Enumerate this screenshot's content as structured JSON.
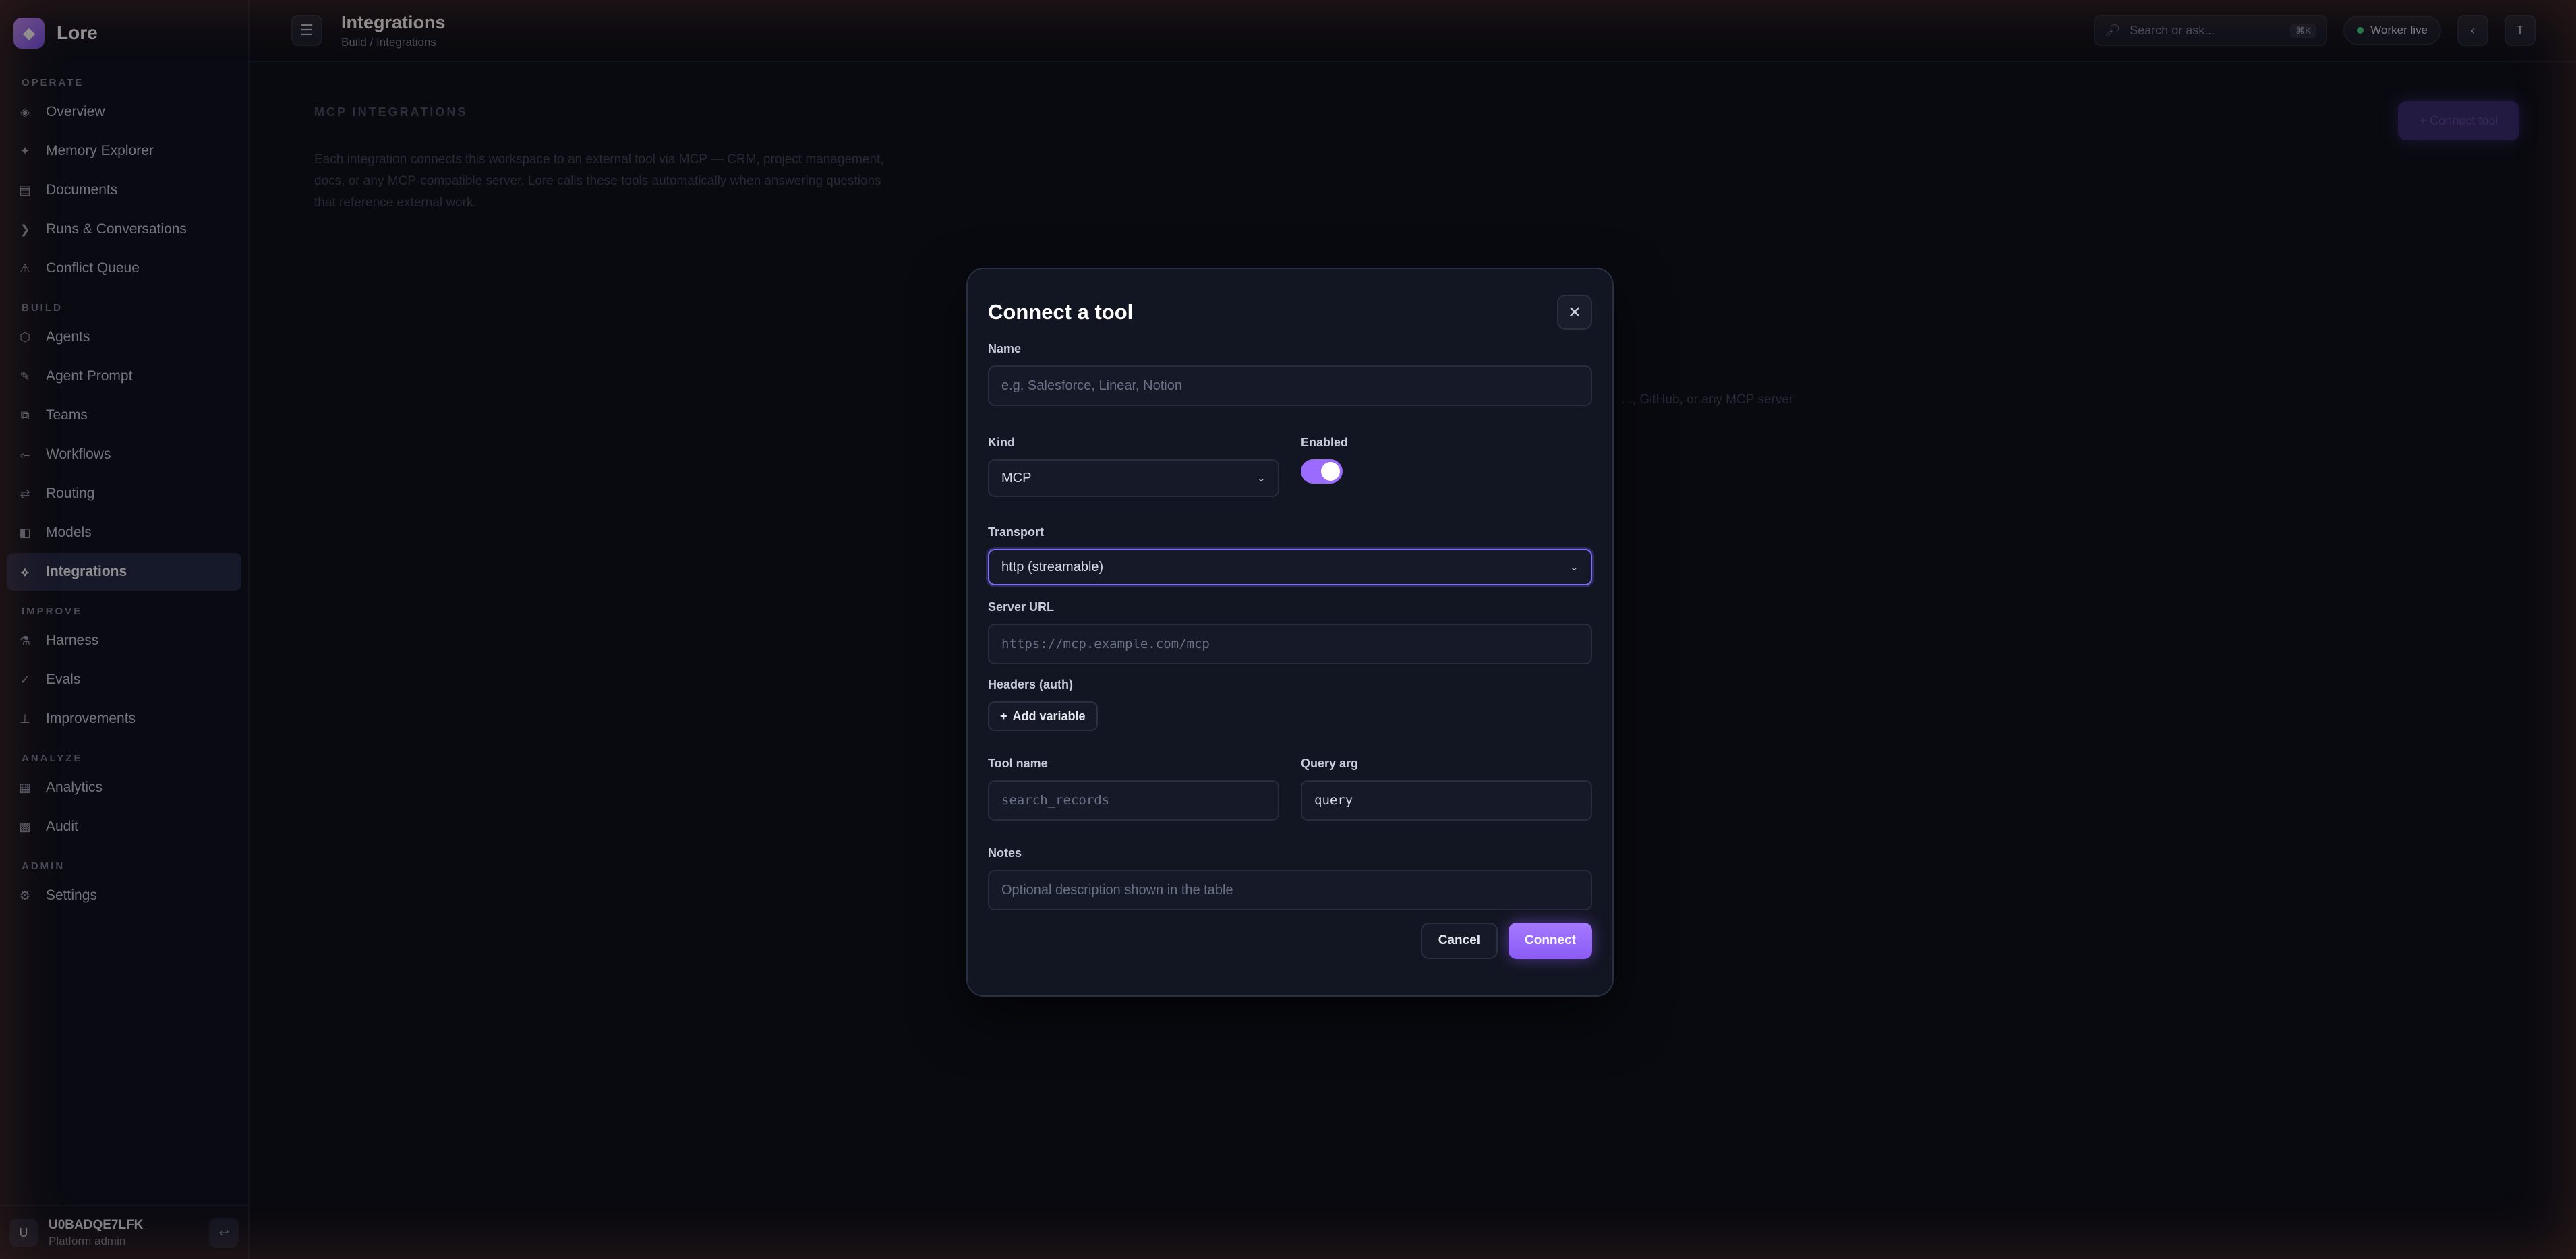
{
  "brand": {
    "name": "Lore"
  },
  "sidebar": {
    "sections": {
      "operate": "OPERATE",
      "build": "BUILD",
      "improve": "IMPROVE",
      "analyze": "ANALYZE",
      "admin": "ADMIN"
    },
    "items": {
      "overview": "Overview",
      "memory_explorer": "Memory Explorer",
      "documents": "Documents",
      "runs": "Runs & Conversations",
      "conflict_queue": "Conflict Queue",
      "agents": "Agents",
      "agent_prompt": "Agent Prompt",
      "teams": "Teams",
      "workflows": "Workflows",
      "routing": "Routing",
      "models": "Models",
      "integrations": "Integrations",
      "harness": "Harness",
      "evals": "Evals",
      "improvements": "Improvements",
      "analytics": "Analytics",
      "audit": "Audit",
      "settings": "Settings"
    },
    "user": {
      "avatar": "U",
      "name": "U0BADQE7LFK",
      "role": "Platform admin"
    }
  },
  "header": {
    "title": "Integrations",
    "breadcrumb": "Build / Integrations",
    "search_placeholder": "Search or ask...",
    "search_shortcut": "⌘K",
    "status": "Worker live",
    "avatar": "T"
  },
  "page": {
    "section_title": "MCP INTEGRATIONS",
    "description": "Each integration connects this workspace to an external tool via MCP — CRM, project management, docs, or any MCP-compatible server. Lore calls these tools automatically when answering questions that reference external work.",
    "connect_button": "+ Connect tool",
    "behind_text": "..., GitHub, or any MCP server"
  },
  "modal": {
    "title": "Connect a tool",
    "name_label": "Name",
    "name_placeholder": "e.g. Salesforce, Linear, Notion",
    "kind_label": "Kind",
    "kind_value": "MCP",
    "enabled_label": "Enabled",
    "enabled": true,
    "transport_label": "Transport",
    "transport_value": "http (streamable)",
    "server_url_label": "Server URL",
    "server_url_placeholder": "https://mcp.example.com/mcp",
    "headers_label": "Headers (auth)",
    "add_variable": "Add variable",
    "tool_name_label": "Tool name",
    "tool_name_placeholder": "search_records",
    "query_arg_label": "Query arg",
    "query_arg_value": "query",
    "notes_label": "Notes",
    "notes_placeholder": "Optional description shown in the table",
    "cancel": "Cancel",
    "connect": "Connect"
  },
  "colors": {
    "accent": "#9b6bff",
    "status_live": "#3ddc84",
    "background": "#0b0d14"
  }
}
